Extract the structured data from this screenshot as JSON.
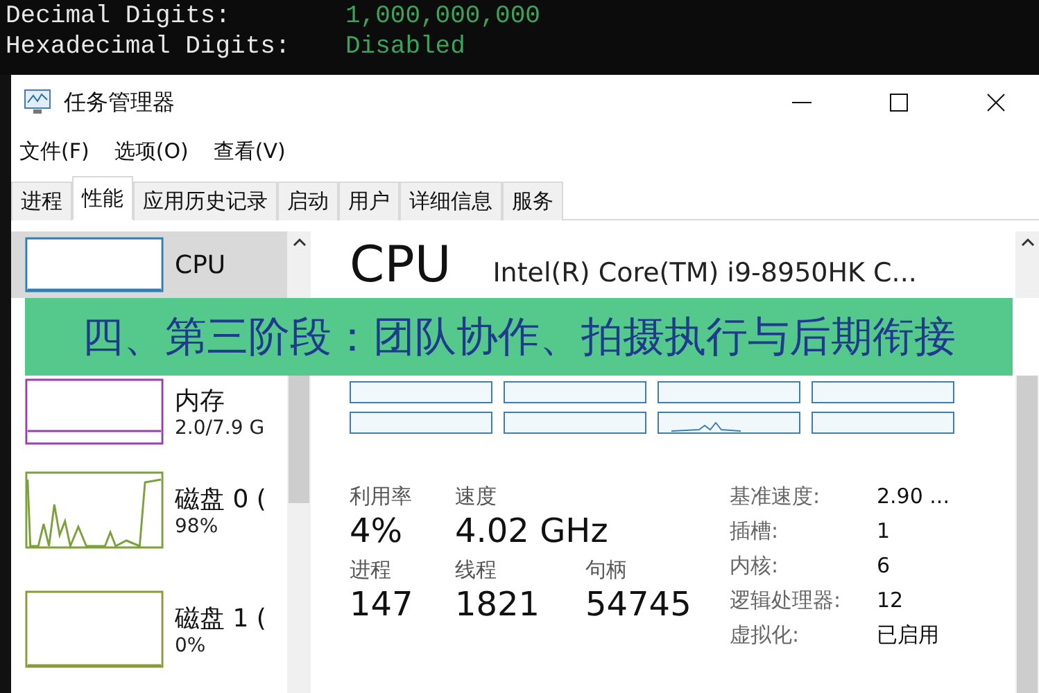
{
  "console": {
    "lines": [
      {
        "label": "Decimal Digits:",
        "value": "1,000,000,000"
      },
      {
        "label": "Hexadecimal Digits:",
        "value": "Disabled"
      }
    ]
  },
  "window": {
    "title": "任务管理器"
  },
  "menu": [
    "文件(F)",
    "选项(O)",
    "查看(V)"
  ],
  "tabs": [
    {
      "label": "进程",
      "selected": false
    },
    {
      "label": "性能",
      "selected": true
    },
    {
      "label": "应用历史记录",
      "selected": false
    },
    {
      "label": "启动",
      "selected": false
    },
    {
      "label": "用户",
      "selected": false
    },
    {
      "label": "详细信息",
      "selected": false
    },
    {
      "label": "服务",
      "selected": false
    }
  ],
  "sidebar": {
    "items": [
      {
        "name": "CPU",
        "selected": true,
        "color": "#2f7fb5",
        "kind": "flat"
      },
      {
        "name": "内存",
        "detail": "2.0/7.9 G",
        "selected": false,
        "color": "#9b3fb0",
        "kind": "memory"
      },
      {
        "name": "磁盘 0 (",
        "detail": "98%",
        "selected": false,
        "color": "#7aa13a",
        "kind": "spiky"
      },
      {
        "name": "磁盘 1 (",
        "detail": "0%",
        "selected": false,
        "color": "#8a9a3a",
        "kind": "flat"
      }
    ]
  },
  "main": {
    "title": "CPU",
    "model": "Intel(R) Core(TM) i9-8950HK C...",
    "stats": [
      {
        "label": "利用率",
        "value": "4%"
      },
      {
        "label": "速度",
        "value": "4.02 GHz"
      },
      {
        "label": "进程",
        "value": "147"
      },
      {
        "label": "线程",
        "value": "1821"
      },
      {
        "label": "句柄",
        "value": "54745"
      }
    ],
    "details": [
      {
        "label": "基准速度:",
        "value": "2.90 ..."
      },
      {
        "label": "插槽:",
        "value": "1"
      },
      {
        "label": "内核:",
        "value": "6"
      },
      {
        "label": "逻辑处理器:",
        "value": "12"
      },
      {
        "label": "虚拟化:",
        "value": "已启用"
      }
    ]
  },
  "banner": {
    "text": "四、第三阶段：团队协作、拍摄执行与后期衔接"
  }
}
